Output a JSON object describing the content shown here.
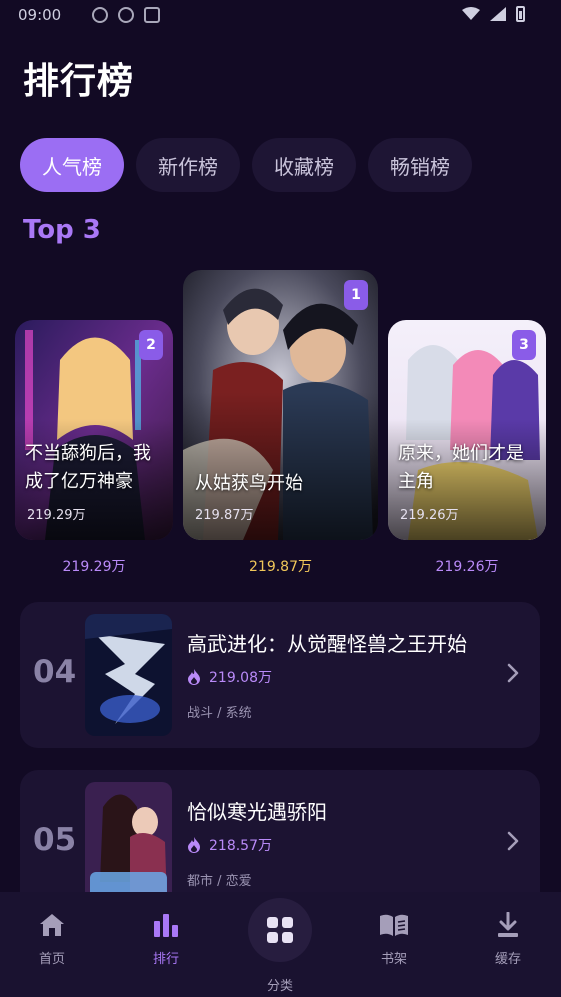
{
  "status_bar": {
    "time": "09:00"
  },
  "page_title": "排行榜",
  "tabs": [
    {
      "label": "人气榜",
      "active": true
    },
    {
      "label": "新作榜",
      "active": false
    },
    {
      "label": "收藏榜",
      "active": false
    },
    {
      "label": "畅销榜",
      "active": false
    }
  ],
  "top3_label": "Top 3",
  "top3": [
    {
      "rank": "2",
      "title": "不当舔狗后，我成了亿万神豪",
      "views": "219.29万",
      "below": "219.29万"
    },
    {
      "rank": "1",
      "title": "从姑获鸟开始",
      "views": "219.87万",
      "below": "219.87万"
    },
    {
      "rank": "3",
      "title": "原来，她们才是主角",
      "views": "219.26万",
      "below": "219.26万"
    }
  ],
  "list": [
    {
      "num": "04",
      "title": "高武进化：从觉醒怪兽之王开始",
      "heat": "219.08万",
      "tags": "战斗 / 系统"
    },
    {
      "num": "05",
      "title": "恰似寒光遇骄阳",
      "heat": "218.57万",
      "tags": "都市 / 恋爱"
    }
  ],
  "bottom_nav": {
    "home": "首页",
    "ranking": "排行",
    "category": "分类",
    "shelf": "书架",
    "cache": "缓存"
  },
  "colors": {
    "background": "#120a24",
    "accent": "#9b6ef3",
    "gold": "#f0c75a",
    "card": "#1c1332"
  },
  "icons": [
    "home-icon",
    "bar-chart-icon",
    "grid-icon",
    "book-icon",
    "download-icon",
    "flame-icon",
    "chevron-right-icon",
    "wifi-icon",
    "signal-icon",
    "battery-icon"
  ]
}
